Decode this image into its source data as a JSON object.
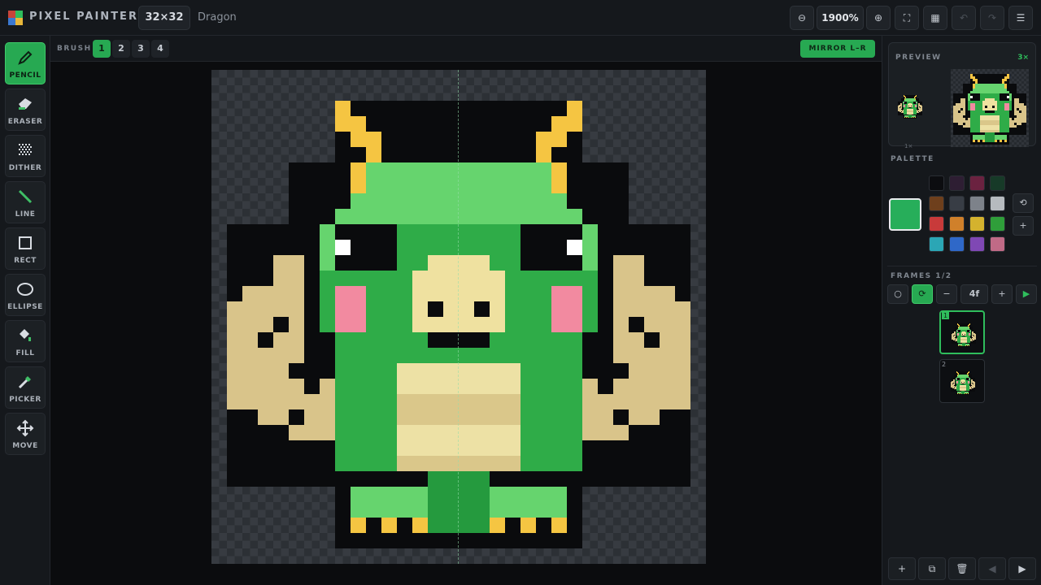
{
  "app": {
    "title": "PIXEL PAINTER",
    "canvas_size": "32×32",
    "document_name": "Dragon",
    "zoom": "1900%"
  },
  "tools": [
    {
      "id": "pencil",
      "label": "PENCIL",
      "active": true
    },
    {
      "id": "eraser",
      "label": "ERASER",
      "active": false
    },
    {
      "id": "dither",
      "label": "DITHER",
      "active": false
    },
    {
      "id": "line",
      "label": "LINE",
      "active": false
    },
    {
      "id": "rect",
      "label": "RECT",
      "active": false
    },
    {
      "id": "ellipse",
      "label": "ELLIPSE",
      "active": false
    },
    {
      "id": "fill",
      "label": "FILL",
      "active": false
    },
    {
      "id": "picker",
      "label": "PICKER",
      "active": false
    },
    {
      "id": "move",
      "label": "MOVE",
      "active": false
    }
  ],
  "brush": {
    "label": "BRUSH",
    "sizes": [
      "1",
      "2",
      "3",
      "4"
    ],
    "active_size": "1"
  },
  "mirror": {
    "label": "MIRROR L–R",
    "enabled": true
  },
  "preview": {
    "label": "PREVIEW",
    "zoom": "3×",
    "small_label": "1×"
  },
  "palette": {
    "label": "PALETTE",
    "current": "#27ae5a",
    "colors": [
      "#0c0d10",
      "#2e1e33",
      "#6b2240",
      "#173a28",
      "#6e3f1c",
      "#383d45",
      "#7d828a",
      "#b6babf",
      "#c83a3a",
      "#d0802a",
      "#d4b22e",
      "#2f9e3a",
      "#2ba6b5",
      "#2f68c8",
      "#7f48b4",
      "#c06a86"
    ]
  },
  "frames": {
    "label": "FRAMES 1/2",
    "fps": "4f",
    "items": [
      {
        "num": "1",
        "active": true
      },
      {
        "num": "2",
        "active": false
      }
    ]
  },
  "colors": {
    "accent": "#27a952",
    "dark": "#0a0b0d",
    "green_light": "#66d46e",
    "green": "#2fac48",
    "green_dark": "#259a3e",
    "horn": "#f5c542",
    "tan": "#d9c48a",
    "tan_light": "#efe1a0",
    "belly_light": "#ede1a5",
    "belly_shade": "#dac78a",
    "cheek": "#f28aa0",
    "white": "#ffffff"
  }
}
